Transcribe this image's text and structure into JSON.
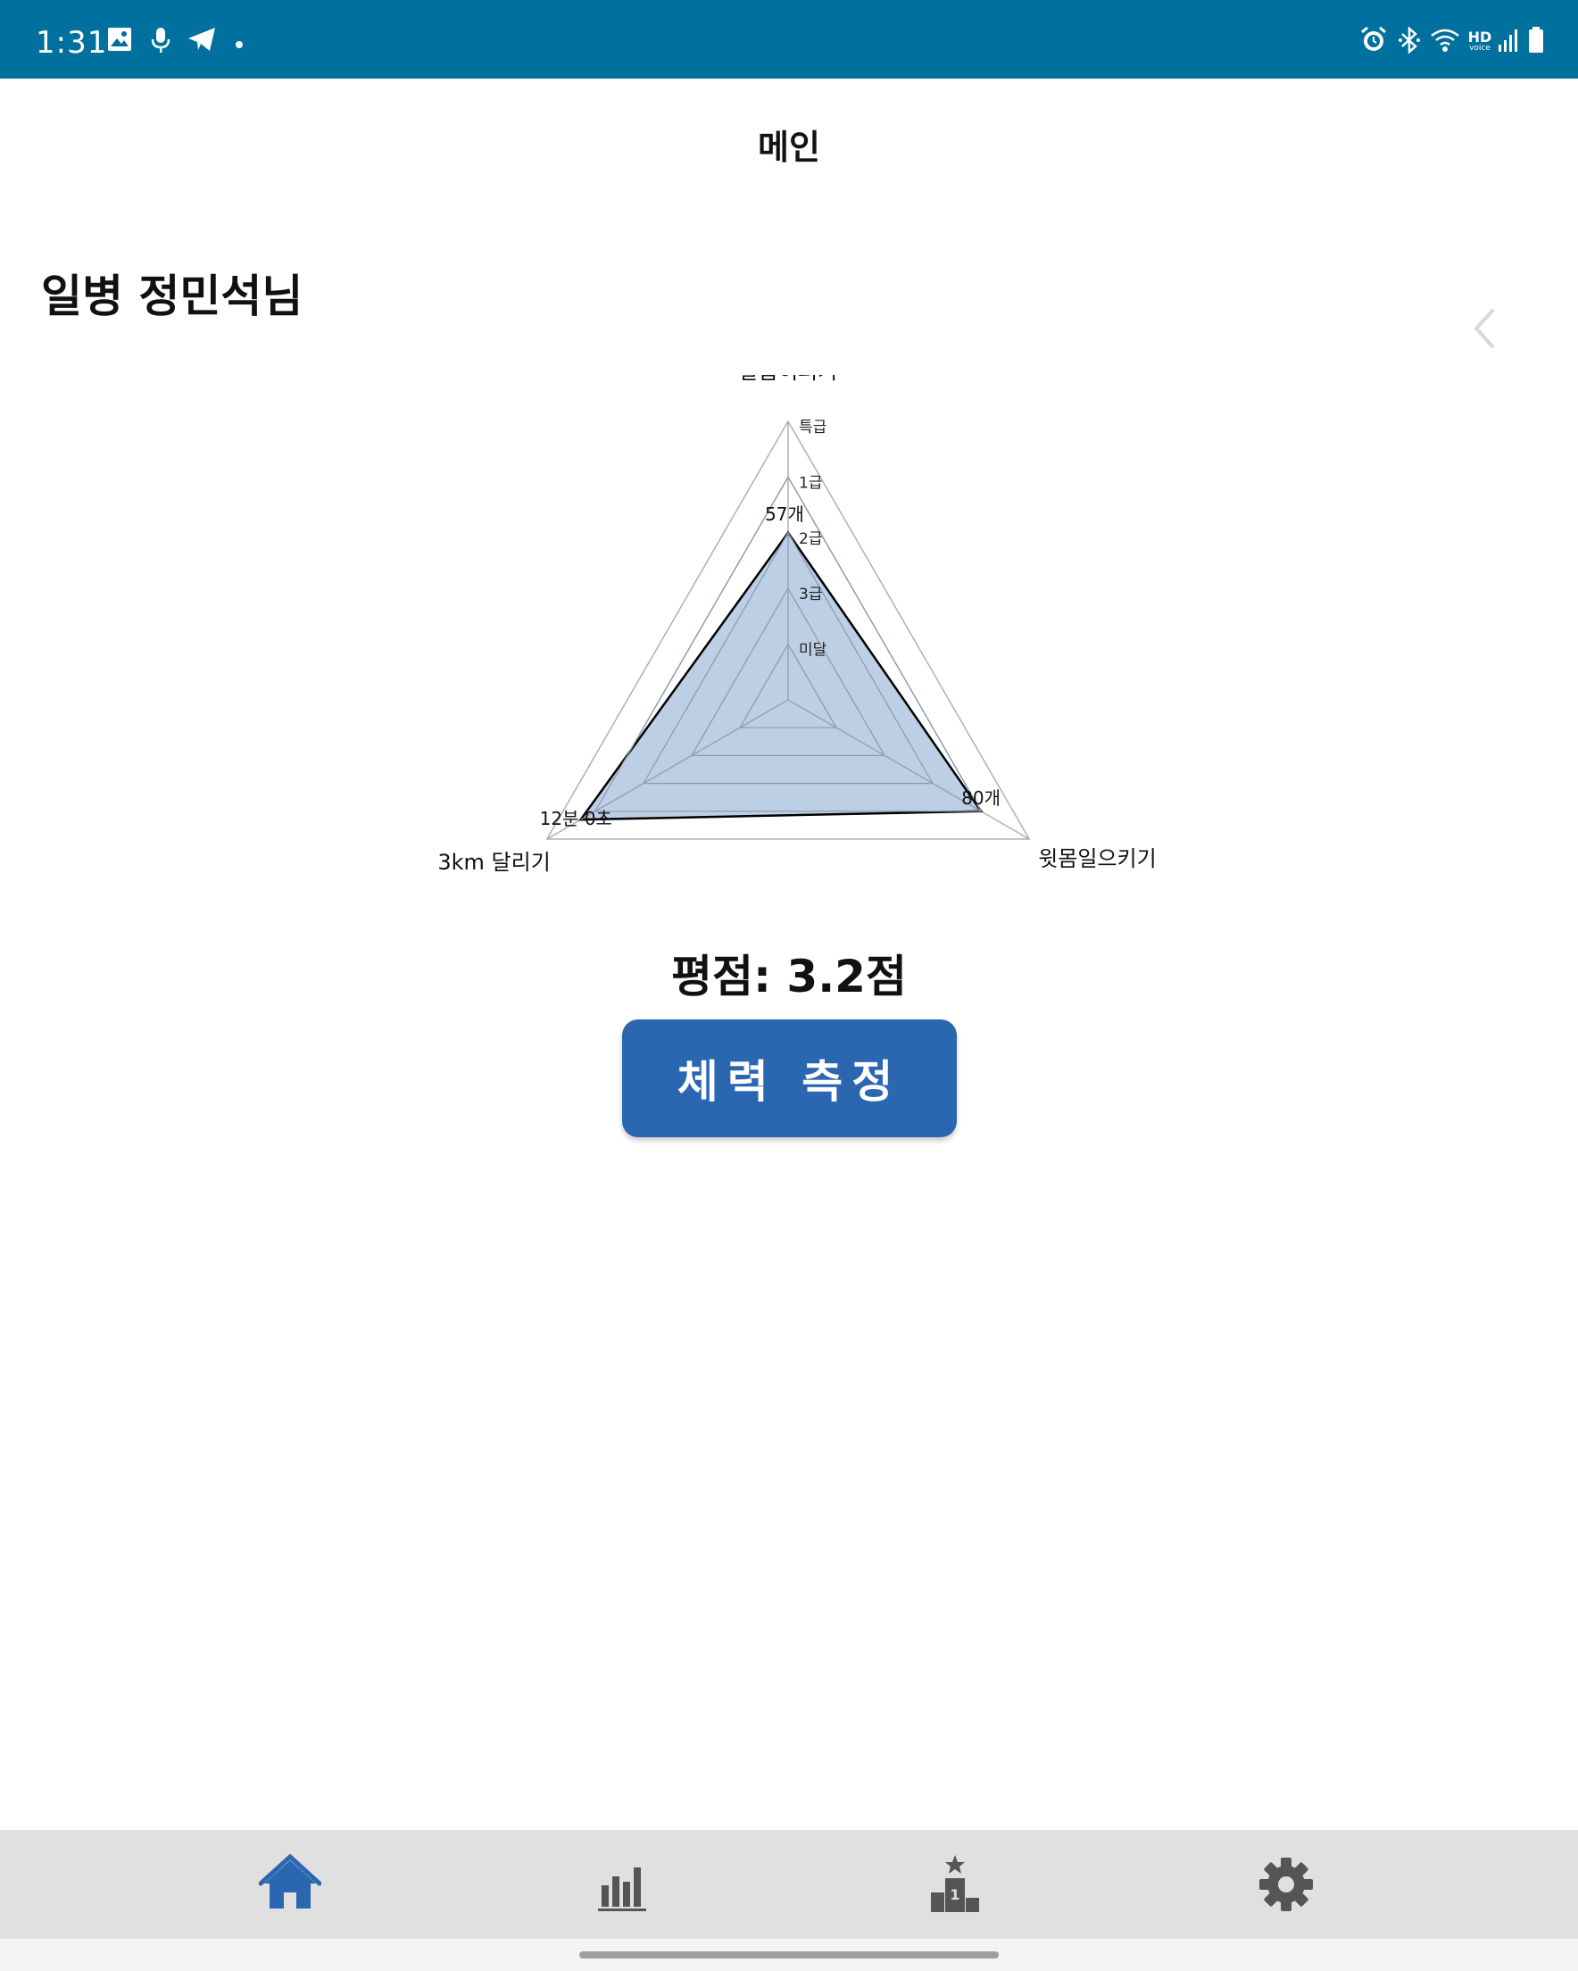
{
  "status_bar": {
    "time": "1:31",
    "left_icons": [
      "image-icon",
      "microphone-icon",
      "telegram-icon",
      "dot-icon"
    ],
    "right_icons": [
      "alarm-icon",
      "bluetooth-icon",
      "wifi-icon",
      "hd-voice-icon",
      "signal-icon",
      "battery-icon"
    ],
    "hd_label": "HD",
    "voice_label": "voice",
    "background_color": "#00709e"
  },
  "header": {
    "title": "메인"
  },
  "user": {
    "name": "일병 정민석님"
  },
  "chart_data": {
    "type": "radar",
    "axes": [
      "팔굽혀펴기",
      "윗몸일으키기",
      "3km 달리기"
    ],
    "grade_levels": [
      "미달",
      "3급",
      "2급",
      "1급",
      "특급"
    ],
    "values": [
      3,
      4,
      4.3
    ],
    "value_labels": [
      "57개",
      "80개",
      "12분 0초"
    ],
    "fill_color": "#b8cce4",
    "stroke_color": "#000000"
  },
  "score": {
    "text": "평점: 3.2점"
  },
  "measure_button": {
    "label": "체력 측정",
    "color": "#2a67b0"
  },
  "bottom_nav": {
    "items": [
      {
        "icon": "home-icon",
        "active": true
      },
      {
        "icon": "bar-chart-icon",
        "active": false
      },
      {
        "icon": "ranking-podium-icon",
        "active": false
      },
      {
        "icon": "gear-icon",
        "active": false
      }
    ],
    "active_color": "#2a67b0",
    "inactive_color": "#555555"
  }
}
